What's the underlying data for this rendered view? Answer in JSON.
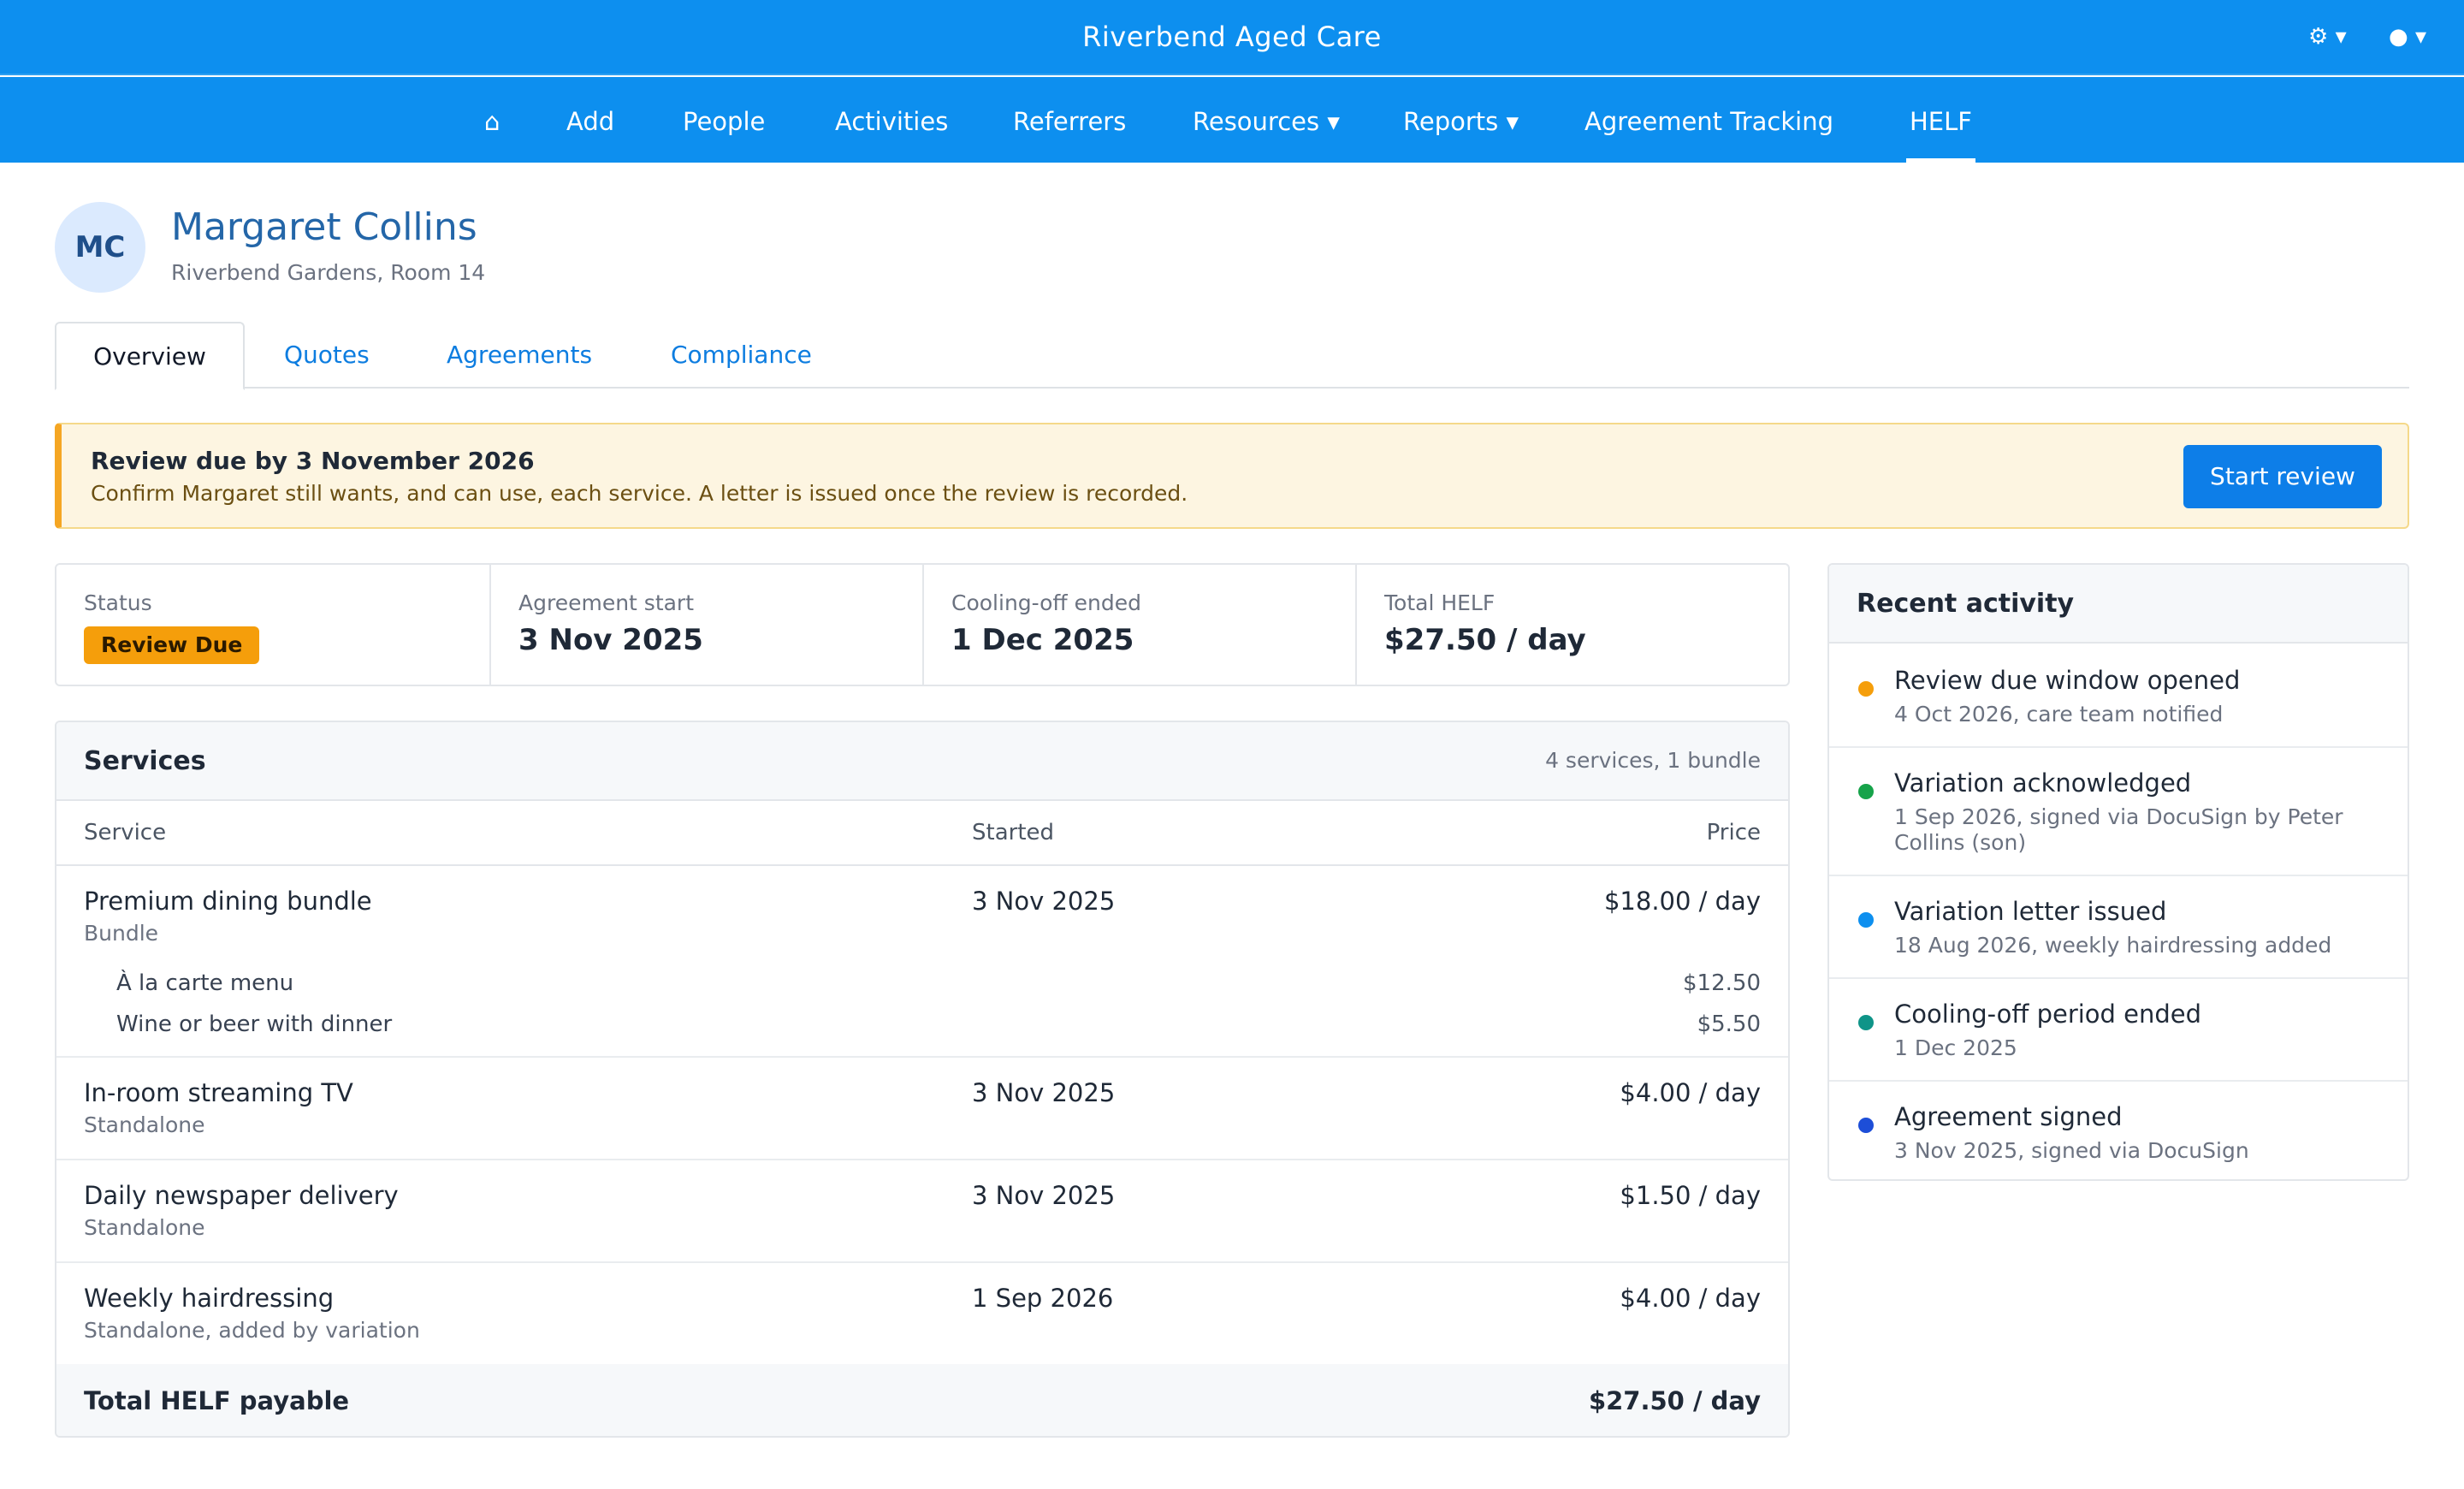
{
  "app": {
    "title": "Riverbend Aged Care",
    "settings_icon": "⚙ ▾",
    "user_icon": "● ▾"
  },
  "nav": {
    "home_icon": "⌂",
    "items": [
      "Add",
      "People",
      "Activities",
      "Referrers",
      "Resources ▾",
      "Reports ▾",
      "Agreement Tracking",
      "HELF"
    ],
    "active": "HELF"
  },
  "person": {
    "initials": "MC",
    "name": "Margaret Collins",
    "location": "Riverbend Gardens, Room 14"
  },
  "tabs": [
    "Overview",
    "Quotes",
    "Agreements",
    "Compliance"
  ],
  "active_tab": "Overview",
  "alert": {
    "title": "Review due by 3 November 2026",
    "text": "Confirm Margaret still wants, and can use, each service. A letter is issued once the review is recorded.",
    "button": "Start review"
  },
  "stats": [
    {
      "label": "Status",
      "badge": "Review Due",
      "badge_color": "#f59e0b"
    },
    {
      "label": "Agreement start",
      "value": "3 Nov 2025"
    },
    {
      "label": "Cooling-off ended",
      "value": "1 Dec 2025"
    },
    {
      "label": "Total HELF",
      "value": "$27.50 / day"
    }
  ],
  "services": {
    "title": "Services",
    "meta": "4 services, 1 bundle",
    "columns": [
      "Service",
      "Started",
      "Price"
    ],
    "rows": [
      {
        "name": "Premium dining bundle",
        "type": "Bundle",
        "started": "3 Nov 2025",
        "price": "$18.00 / day",
        "items": [
          {
            "name": "À la carte menu",
            "price": "$12.50"
          },
          {
            "name": "Wine or beer with dinner",
            "price": "$5.50"
          }
        ]
      },
      {
        "name": "In-room streaming TV",
        "type": "Standalone",
        "started": "3 Nov 2025",
        "price": "$4.00 / day"
      },
      {
        "name": "Daily newspaper delivery",
        "type": "Standalone",
        "started": "3 Nov 2025",
        "price": "$1.50 / day"
      },
      {
        "name": "Weekly hairdressing",
        "type": "Standalone, added by variation",
        "started": "1 Sep 2026",
        "price": "$4.00 / day"
      }
    ],
    "total_label": "Total HELF payable",
    "total_value": "$27.50 / day"
  },
  "activity": {
    "title": "Recent activity",
    "items": [
      {
        "title": "Review due window opened",
        "sub": "4 Oct 2026, care team notified",
        "color": "#f59e0b"
      },
      {
        "title": "Variation acknowledged",
        "sub": "1 Sep 2026, signed via DocuSign by Peter Collins (son)",
        "color": "#16a34a"
      },
      {
        "title": "Variation letter issued",
        "sub": "18 Aug 2026, weekly hairdressing added",
        "color": "#0d8fef"
      },
      {
        "title": "Cooling-off period ended",
        "sub": "1 Dec 2025",
        "color": "#0f9488"
      },
      {
        "title": "Agreement signed",
        "sub": "3 Nov 2025, signed via DocuSign",
        "color": "#1d4ed8"
      }
    ]
  }
}
